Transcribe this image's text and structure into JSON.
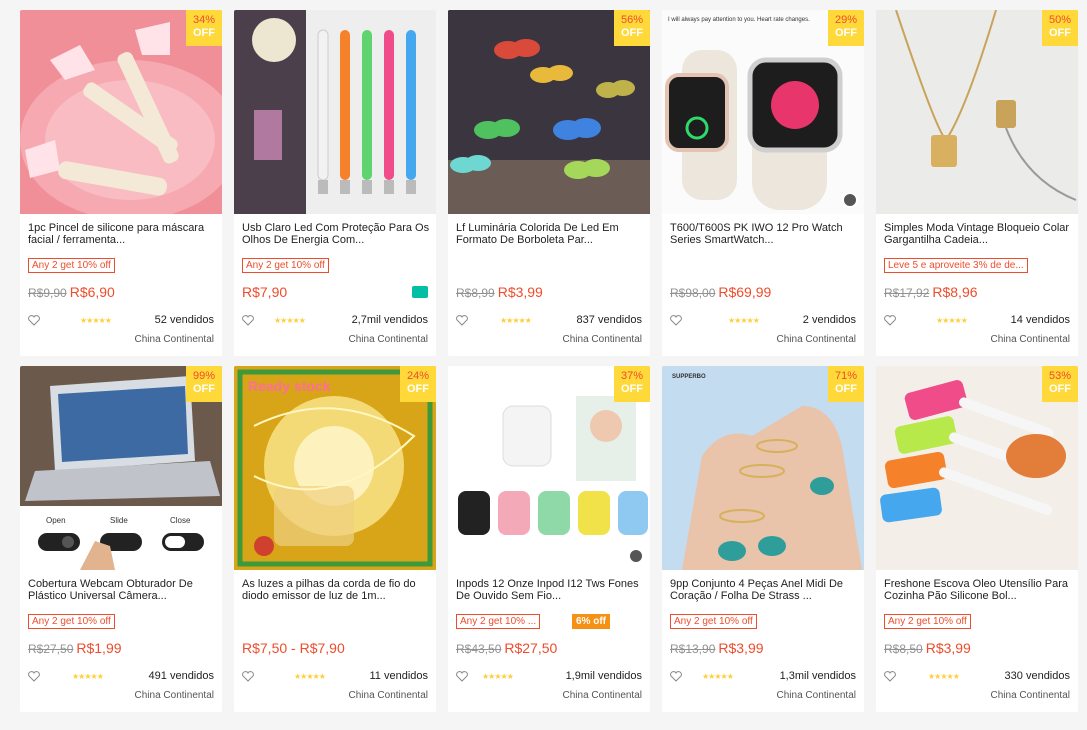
{
  "products": [
    {
      "discount": "34%",
      "off": "OFF",
      "title": "1pc Pincel de silicone para máscara facial / ferramenta...",
      "promo": "Any 2 get 10% off",
      "old_price": "R$9,90",
      "price": "R$6,90",
      "rating": "★★★★★",
      "sold": "52 vendidos",
      "location": "China Continental"
    },
    {
      "discount": "",
      "off": "",
      "title": "Usb Claro Led Com Proteção Para Os Olhos De Energia Com...",
      "promo": "Any 2 get 10% off",
      "old_price": "",
      "price": "R$7,90",
      "rating": "★★★★★",
      "sold": "2,7mil vendidos",
      "location": "China Continental"
    },
    {
      "discount": "56%",
      "off": "OFF",
      "title": "Lf Luminária Colorida De Led Em Formato De Borboleta Par...",
      "promo": "",
      "old_price": "R$8,99",
      "price": "R$3,99",
      "rating": "★★★★★",
      "sold": "837 vendidos",
      "location": "China Continental"
    },
    {
      "discount": "29%",
      "off": "OFF",
      "title": "T600/T600S PK IWO 12 Pro Watch Series SmartWatch...",
      "promo": "",
      "old_price": "R$98,00",
      "price": "R$69,99",
      "rating": "★★★★★",
      "sold": "2 vendidos",
      "location": "China Continental"
    },
    {
      "discount": "50%",
      "off": "OFF",
      "title": "Simples Moda Vintage Bloqueio Colar Gargantilha Cadeia...",
      "promo": "Leve 5 e aproveite 3% de de...",
      "old_price": "R$17,92",
      "price": "R$8,96",
      "rating": "★★★★★",
      "sold": "14 vendidos",
      "location": "China Continental"
    },
    {
      "discount": "99%",
      "off": "OFF",
      "title": "Cobertura Webcam Obturador De Plástico Universal Câmera...",
      "promo": "Any 2 get 10% off",
      "old_price": "R$27,50",
      "price": "R$1,99",
      "rating": "★★★★★",
      "sold": "491 vendidos",
      "location": "China Continental"
    },
    {
      "discount": "24%",
      "off": "OFF",
      "title": "As luzes a pilhas da corda de fio do diodo emissor de luz de 1m...",
      "promo": "",
      "old_price": "",
      "price": "R$7,50 - R$7,90",
      "rating": "★★★★★",
      "sold": "11 vendidos",
      "location": "China Continental"
    },
    {
      "discount": "37%",
      "off": "OFF",
      "title": "Inpods 12 Onze Inpod I12 Tws Fones De Ouvido Sem Fio...",
      "promo": "Any 2 get 10% ...",
      "promo2": "6% off",
      "old_price": "R$43,50",
      "price": "R$27,50",
      "rating": "★★★★★",
      "sold": "1,9mil vendidos",
      "location": "China Continental"
    },
    {
      "discount": "71%",
      "off": "OFF",
      "title": "9pp Conjunto 4 Peças Anel Midi De Coração / Folha De Strass ...",
      "promo": "Any 2 get 10% off",
      "old_price": "R$13,90",
      "price": "R$3,99",
      "rating": "★★★★★",
      "sold": "1,3mil vendidos",
      "location": "China Continental"
    },
    {
      "discount": "53%",
      "off": "OFF",
      "title": "Freshone Escova Oleo Utensílio Para Cozinha Pão Silicone Bol...",
      "promo": "Any 2 get 10% off",
      "old_price": "R$8,50",
      "price": "R$3,99",
      "rating": "★★★★★",
      "sold": "330 vendidos",
      "location": "China Continental"
    }
  ],
  "image_texts": {
    "watch_caption": "I will always pay attention to you. Heart rate changes.",
    "ready_stock": "Ready stock",
    "webcam_open": "Open",
    "webcam_slide": "Slide",
    "webcam_close": "Close",
    "ring_brand": "SUPPERBO"
  },
  "colors": {
    "accent": "#ee4d2d",
    "badge": "#ffd839",
    "star": "#ffce3d"
  }
}
